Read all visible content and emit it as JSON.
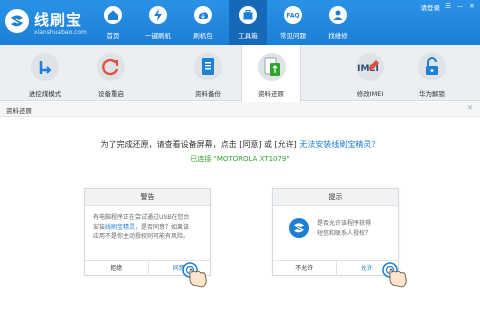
{
  "app": {
    "title": "线刷宝",
    "subtitle": "xianshuabao.com",
    "top_links": {
      "login": "请登录",
      "menu": "☰",
      "minimize": "—",
      "close": "✕"
    }
  },
  "nav": [
    {
      "label": "首页",
      "icon": "home-icon",
      "active": false
    },
    {
      "label": "一键刷机",
      "icon": "flash-icon",
      "active": false
    },
    {
      "label": "刷机包",
      "icon": "package-icon",
      "active": false
    },
    {
      "label": "工具箱",
      "icon": "toolbox-icon",
      "active": true
    },
    {
      "label": "常见问题",
      "icon": "faq-icon",
      "active": false
    },
    {
      "label": "找维修",
      "icon": "repair-icon",
      "active": false
    }
  ],
  "tools": [
    {
      "label": "进挖煤模式",
      "icon": "download-mode-icon",
      "active": false
    },
    {
      "label": "设备重启",
      "icon": "reboot-icon",
      "active": false
    },
    {
      "label": "资料备份",
      "icon": "backup-icon",
      "active": false
    },
    {
      "label": "资料还原",
      "icon": "restore-icon",
      "active": true
    },
    {
      "label": "修改IMEI",
      "icon": "imei-icon",
      "active": false
    },
    {
      "label": "华为解锁",
      "icon": "unlock-icon",
      "active": false
    }
  ],
  "section": {
    "title": "资料还原",
    "close": "✕"
  },
  "instruction": {
    "text": "为了完成还原，请查看设备屏幕，点击 [同意] 或 [允许]",
    "link": "无法安装线刷宝精灵？"
  },
  "connected": "已连接 \"MOTOROLA XT1079\"",
  "dialogs": {
    "warning": {
      "title": "警告",
      "line1": "有电脑程序正在尝试通过USB在您台",
      "line2_pre": "安装",
      "line2_link": "线刷宝精灵",
      "line2_post": "，是否同意？如果该",
      "line3": "应用不是你主动授权则可能有风险。",
      "deny": "拒绝",
      "ok": "同意"
    },
    "prompt": {
      "title": "提示",
      "line1": "是否允许该程序获得",
      "line2": "短信和联系人授权？",
      "deny": "不允许",
      "ok": "允许"
    }
  },
  "colors": {
    "header": "#1b7fd6",
    "accent": "#1c7fd8",
    "success": "#2fa52f"
  }
}
